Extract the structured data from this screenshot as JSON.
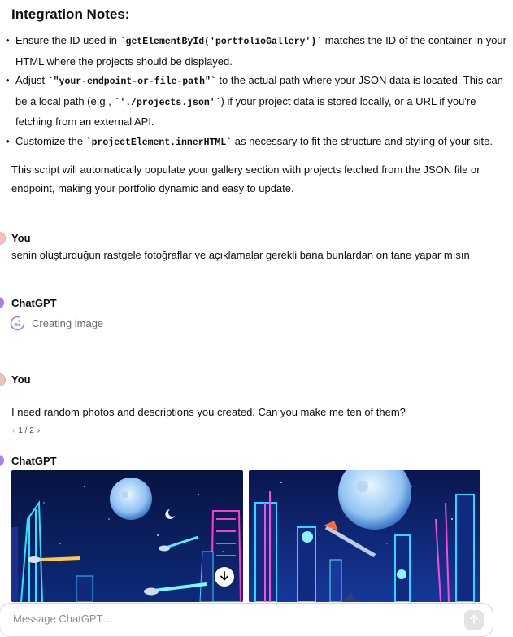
{
  "integration": {
    "title": "Integration Notes:",
    "bullets": [
      {
        "t1": "Ensure the ID used in ",
        "c1": "`getElementById('portfolioGallery')`",
        "t2": " matches the ID of the container in your HTML where the projects should be displayed."
      },
      {
        "t1": "Adjust ",
        "c1": "`\"your-endpoint-or-file-path\"`",
        "t2": " to the actual path where your JSON data is located. This can be a local path (e.g., ",
        "c2": "`'./projects.json'`",
        "t3": ") if your project data is stored locally, or a URL if you're fetching from an external API."
      },
      {
        "t1": "Customize the ",
        "c1": "`projectElement.innerHTML`",
        "t2": " as necessary to fit the structure and styling of your site."
      }
    ],
    "paragraph": "This script will automatically populate your gallery section with projects fetched from the JSON file or endpoint, making your portfolio dynamic and easy to update."
  },
  "conversation": {
    "user_name": "You",
    "assistant_name": "ChatGPT",
    "user_message_1": "senin oluşturduğun rastgele fotoğraflar ve açıklamalar gerekli bana bunlardan on tane yapar mısın",
    "creating_image": "Creating image",
    "user_message_2": "I need random photos and descriptions you created. Can you make me ten of them?",
    "pager": {
      "prev": "‹",
      "label": "1 / 2",
      "next": "›"
    }
  },
  "composer": {
    "placeholder": "Message ChatGPT…"
  },
  "colors": {
    "user_avatar": "#f0c4bd",
    "assistant_avatar": "#a67ef0",
    "image_bg": "#0a1650"
  },
  "icons": [
    "image-creation-icon",
    "download-icon",
    "send-arrow-icon"
  ]
}
